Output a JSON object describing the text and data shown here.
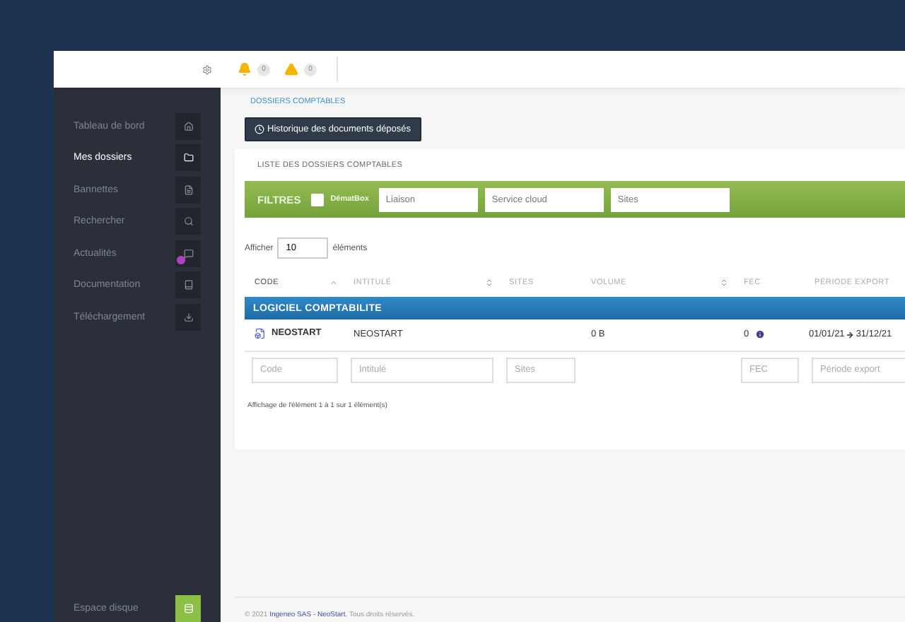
{
  "header": {
    "notifications": "0",
    "warnings": "0"
  },
  "sidebar": {
    "items": [
      {
        "label": "Tableau de bord",
        "selected": false,
        "unread": false
      },
      {
        "label": "Mes dossiers",
        "selected": true,
        "unread": false
      },
      {
        "label": "Bannettes",
        "selected": false,
        "unread": false
      },
      {
        "label": "Rechercher",
        "selected": false,
        "unread": false
      },
      {
        "label": "Actualités",
        "selected": false,
        "unread": true
      },
      {
        "label": "Documentation",
        "selected": false,
        "unread": false
      },
      {
        "label": "Téléchargement",
        "selected": false,
        "unread": false
      }
    ],
    "footer_item": {
      "label": "Espace disque"
    }
  },
  "breadcrumb": "DOSSIERS COMPTABLES",
  "history_button": "Historique des documents déposés",
  "panel": {
    "title": "LISTE DES DOSSIERS COMPTABLES",
    "filters": {
      "title": "FILTRES",
      "checkbox": {
        "label": "DématBox",
        "checked": false
      },
      "fields": [
        {
          "placeholder": "Liaison"
        },
        {
          "placeholder": "Service cloud"
        },
        {
          "placeholder": "Sites"
        }
      ]
    },
    "page_size": {
      "label_before": "Afficher",
      "value": "10",
      "label_after": "éléments"
    },
    "table": {
      "columns": [
        {
          "label": "CODE",
          "sortable": true,
          "sorted": true
        },
        {
          "label": "INTITULÉ",
          "sortable": true,
          "sorted": false
        },
        {
          "label": "SITES",
          "sortable": false,
          "sorted": false
        },
        {
          "label": "VOLUME",
          "sortable": true,
          "sorted": false
        },
        {
          "label": "FEC",
          "sortable": false,
          "sorted": false
        },
        {
          "label": "PÉRIODE EXPORT",
          "sortable": false,
          "sorted": false
        }
      ],
      "group": "LOGICIEL COMPTABILITE",
      "rows": [
        {
          "code": "NEOSTART",
          "title": "NEOSTART",
          "volume": "0 B",
          "fec": "0",
          "period_start": "01/01/21",
          "period_end": "31/12/21"
        }
      ],
      "column_filters": [
        {
          "placeholder": "Code"
        },
        {
          "placeholder": "Intitulé"
        },
        {
          "placeholder": "Sites"
        },
        {
          "kind": "blank"
        },
        {
          "placeholder": "FEC"
        },
        {
          "placeholder": "Période export"
        }
      ]
    },
    "info": "Affichage de l'élément 1 à 1 sur 1 élément(s)"
  },
  "footer": {
    "copyright": "© 2021",
    "company": "Ingeneo SAS - NeoStart.",
    "rights": "Tous droits réservés."
  }
}
